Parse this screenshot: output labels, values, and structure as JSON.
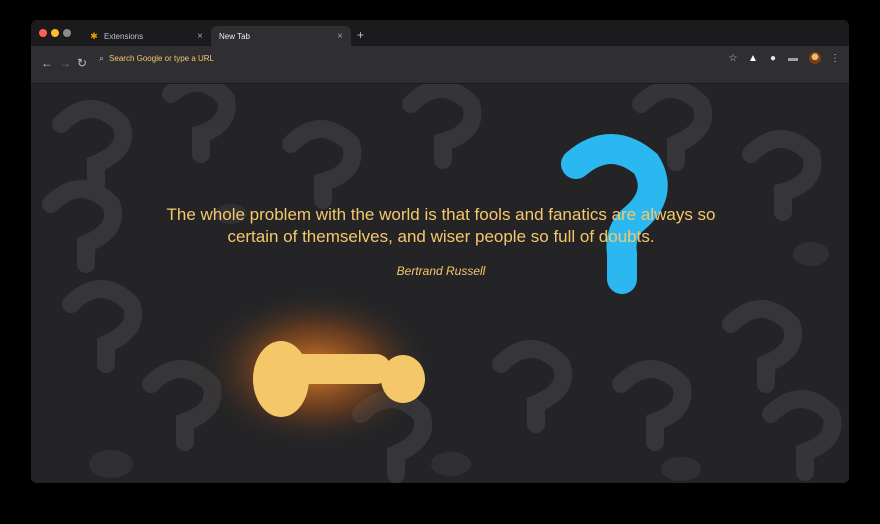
{
  "tabs": [
    {
      "label": "Extensions",
      "active": false
    },
    {
      "label": "New Tab",
      "active": true
    }
  ],
  "omnibox": {
    "placeholder": "Search Google or type a URL"
  },
  "quote": {
    "text": "The whole problem with the world is that fools and fanatics are always so certain of themselves, and wiser people so full of doubts.",
    "author": "Bertrand Russell"
  },
  "colors": {
    "accent": "#f4c869",
    "highlight_blue": "#2bb8f0"
  },
  "icons": {
    "back": "arrow-left-icon",
    "forward": "arrow-right-icon",
    "reload": "reload-icon",
    "search": "search-icon",
    "bookmark": "star-icon",
    "menu": "kebab-menu-icon"
  }
}
